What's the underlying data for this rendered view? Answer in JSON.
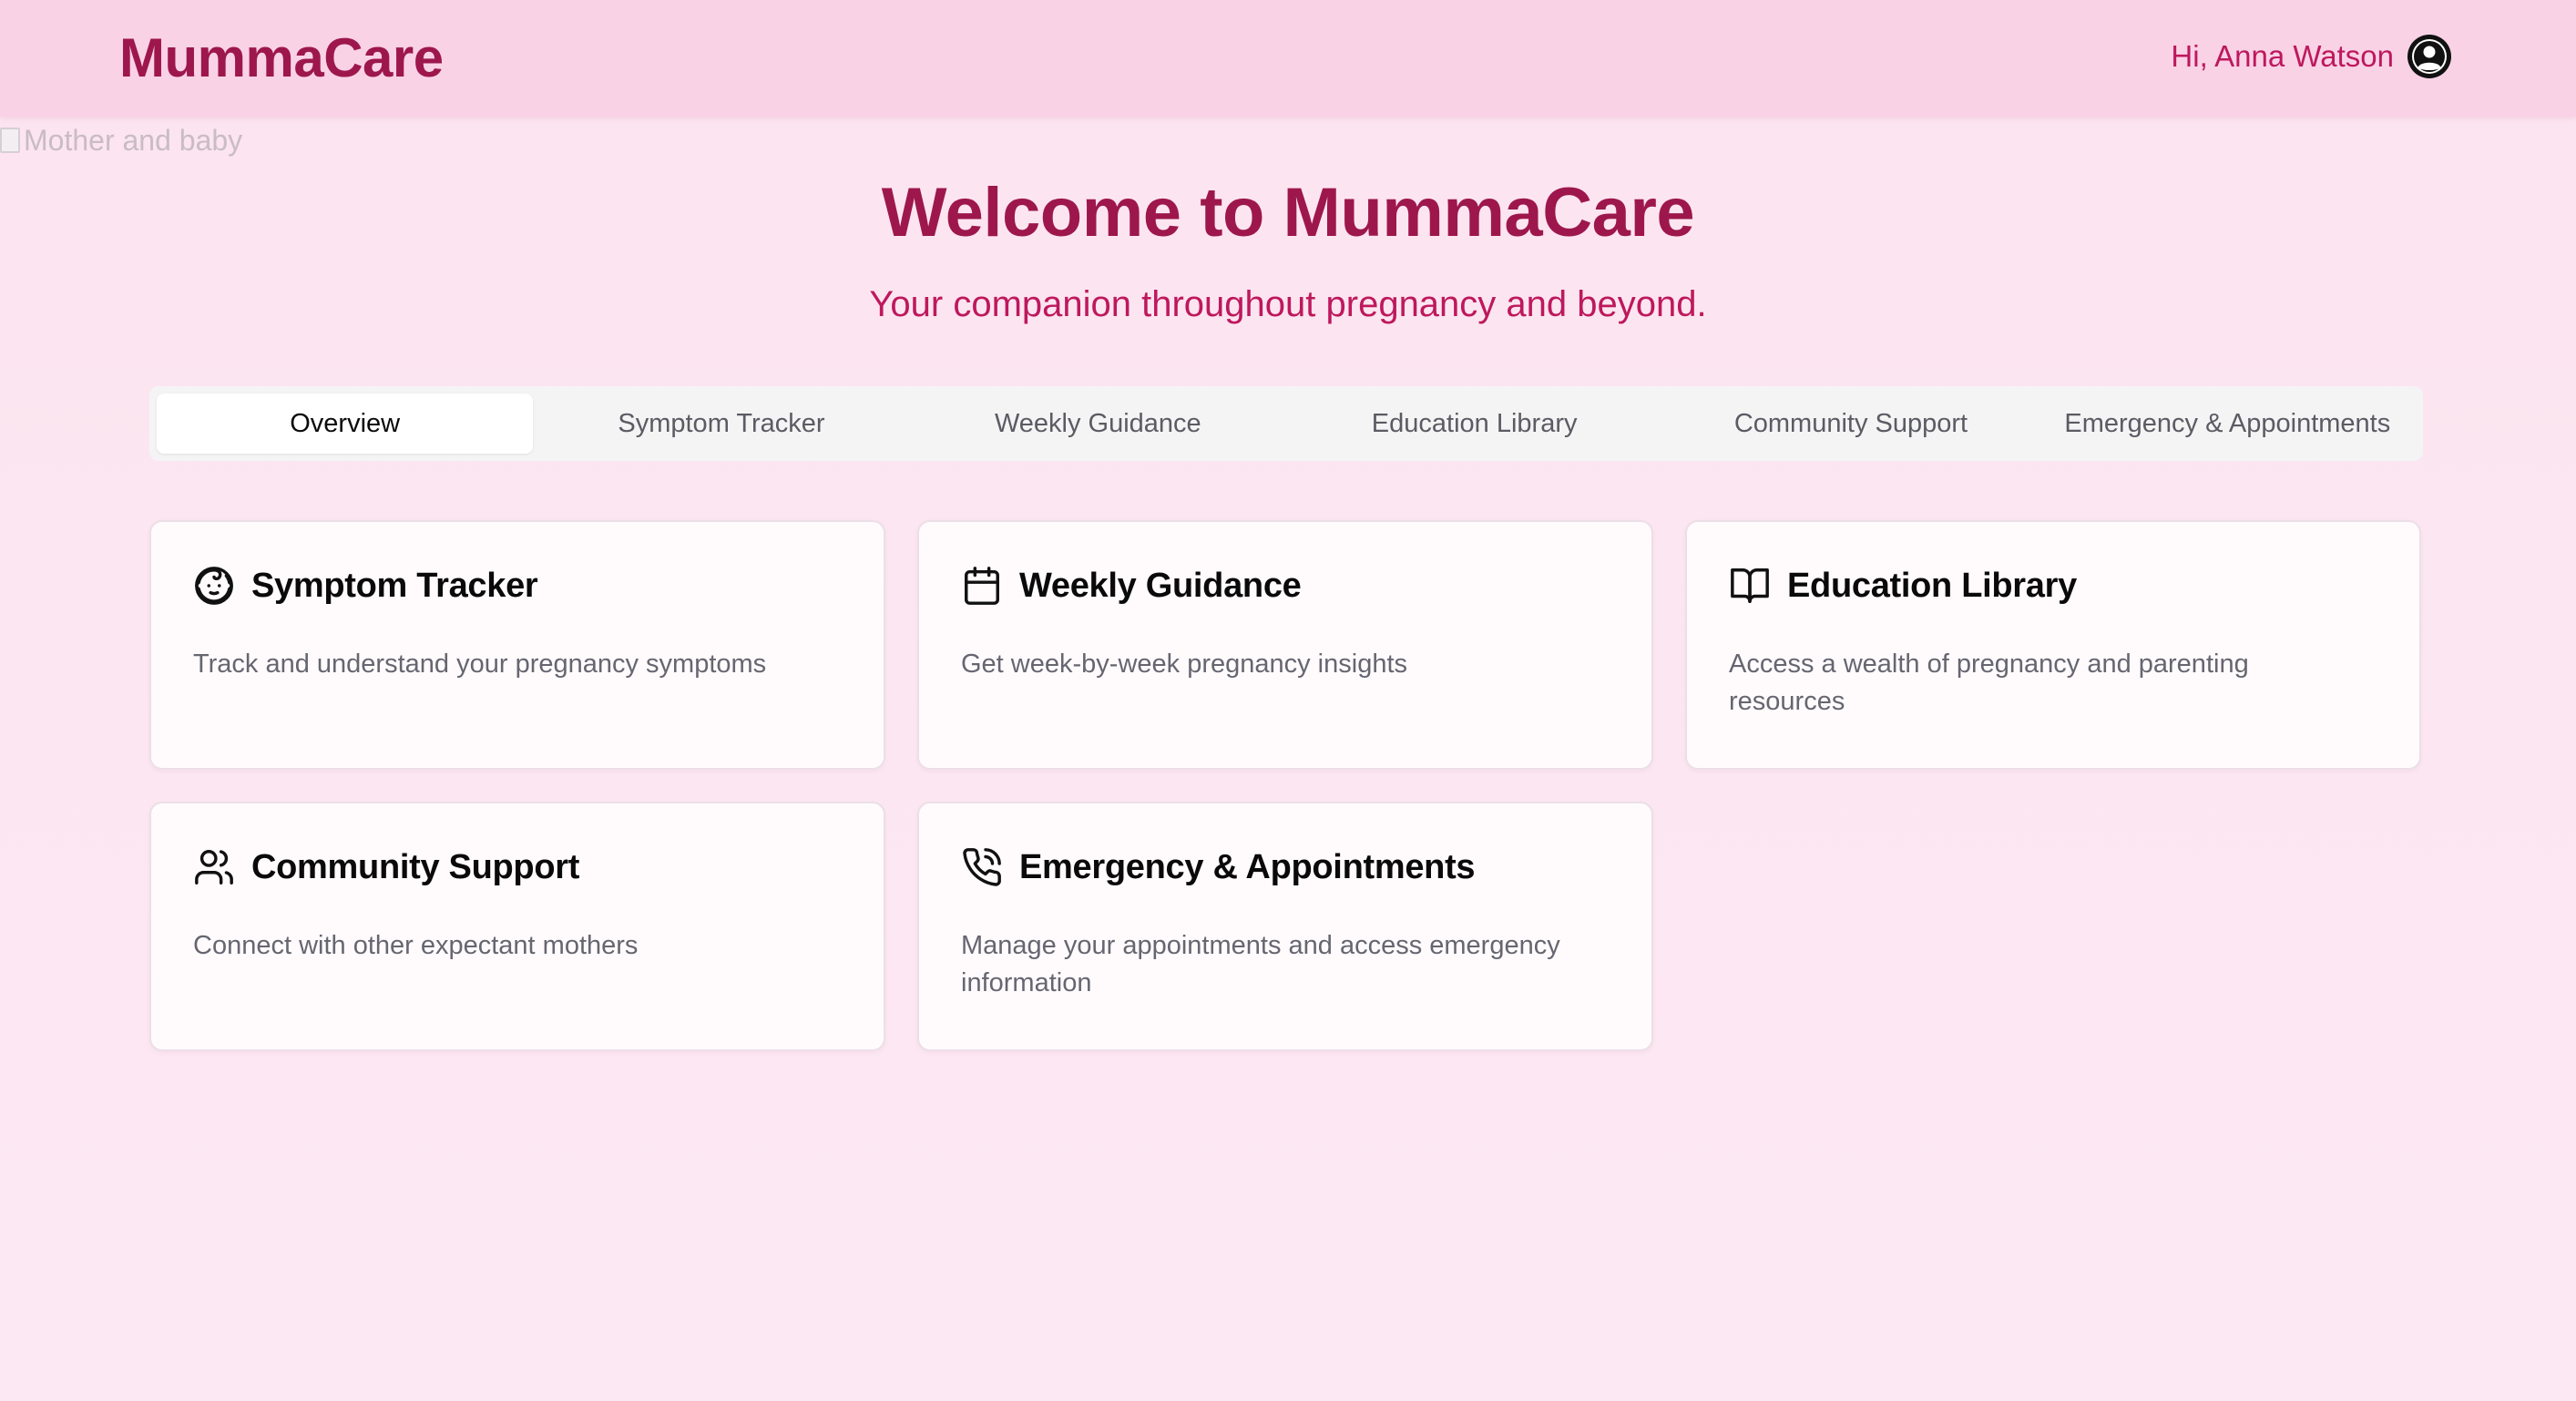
{
  "header": {
    "logo": "MummaCare",
    "greeting": "Hi, Anna Watson",
    "avatar_icon": "user-circle-icon"
  },
  "hero": {
    "image_alt": "Mother and baby",
    "title": "Welcome to MummaCare",
    "subtitle": "Your companion throughout pregnancy and beyond."
  },
  "tabs": [
    {
      "label": "Overview",
      "active": true
    },
    {
      "label": "Symptom Tracker",
      "active": false
    },
    {
      "label": "Weekly Guidance",
      "active": false
    },
    {
      "label": "Education Library",
      "active": false
    },
    {
      "label": "Community Support",
      "active": false
    },
    {
      "label": "Emergency & Appointments",
      "active": false
    }
  ],
  "cards": [
    {
      "title": "Symptom Tracker",
      "description": "Track and understand your pregnancy symptoms",
      "icon": "baby-face-icon"
    },
    {
      "title": "Weekly Guidance",
      "description": "Get week-by-week pregnancy insights",
      "icon": "calendar-icon"
    },
    {
      "title": "Education Library",
      "description": "Access a wealth of pregnancy and parenting resources",
      "icon": "open-book-icon"
    },
    {
      "title": "Community Support",
      "description": "Connect with other expectant mothers",
      "icon": "users-icon"
    },
    {
      "title": "Emergency & Appointments",
      "description": "Manage your appointments and access emergency information",
      "icon": "phone-call-icon"
    }
  ],
  "colors": {
    "brand": "#9d174d",
    "accent": "#be185d",
    "header_bg": "#f9d2e6",
    "page_bg": "#fce7f1"
  }
}
